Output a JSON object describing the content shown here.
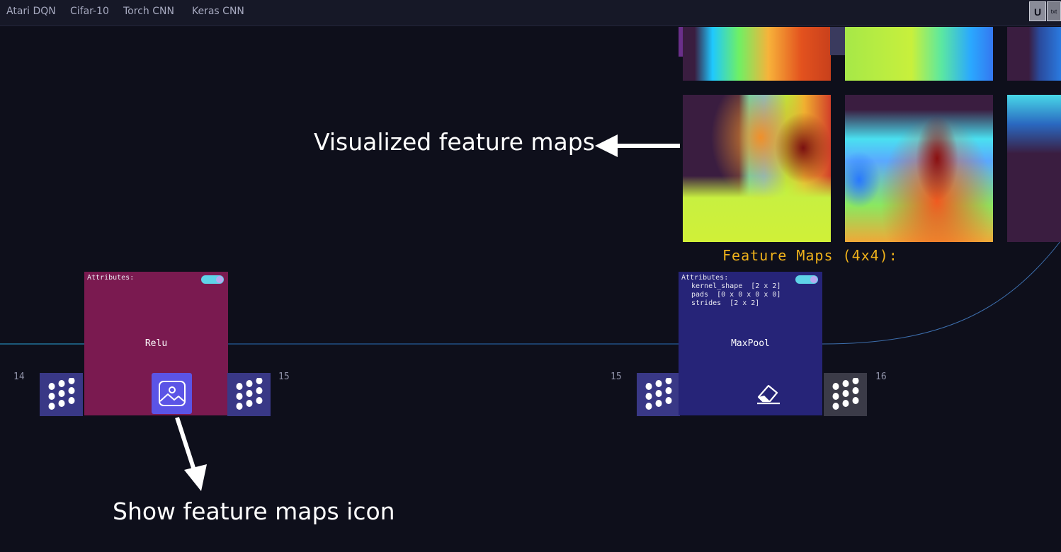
{
  "navbar": {
    "tabs": [
      "Atari DQN",
      "Cifar-10",
      "Torch CNN",
      "Keras CNN"
    ],
    "right_buttons": [
      "U",
      "txt"
    ]
  },
  "feature_maps": {
    "title": "Feature Maps (4x4):"
  },
  "nodes": {
    "relu": {
      "attributes_label": "Attributes:",
      "op_name": "Relu",
      "input_port_number": "14",
      "output_port_number": "15",
      "action_icon": "image-icon"
    },
    "maxpool": {
      "attributes_label": "Attributes:",
      "attributes": [
        "kernel_shape  [2 x 2]",
        "pads  [0 x 0 x 0 x 0]",
        "strides  [2 x 2]"
      ],
      "op_name": "MaxPool",
      "input_port_number": "15",
      "output_port_number": "16",
      "action_icon": "eraser-icon"
    }
  },
  "annotations": {
    "feature_maps_caption": "Visualized feature maps",
    "icon_caption": "Show feature maps icon"
  },
  "colors": {
    "background": "#0e0f1b",
    "relu_node": "#7a1a50",
    "maxpool_node": "#262478",
    "port": "#393886",
    "port_inactive": "#3b3b48",
    "accent_yellow": "#f0b21b",
    "toggle": "#5fd3e8",
    "icon_button": "#5b54e6",
    "wire": "#2aa3d8"
  }
}
